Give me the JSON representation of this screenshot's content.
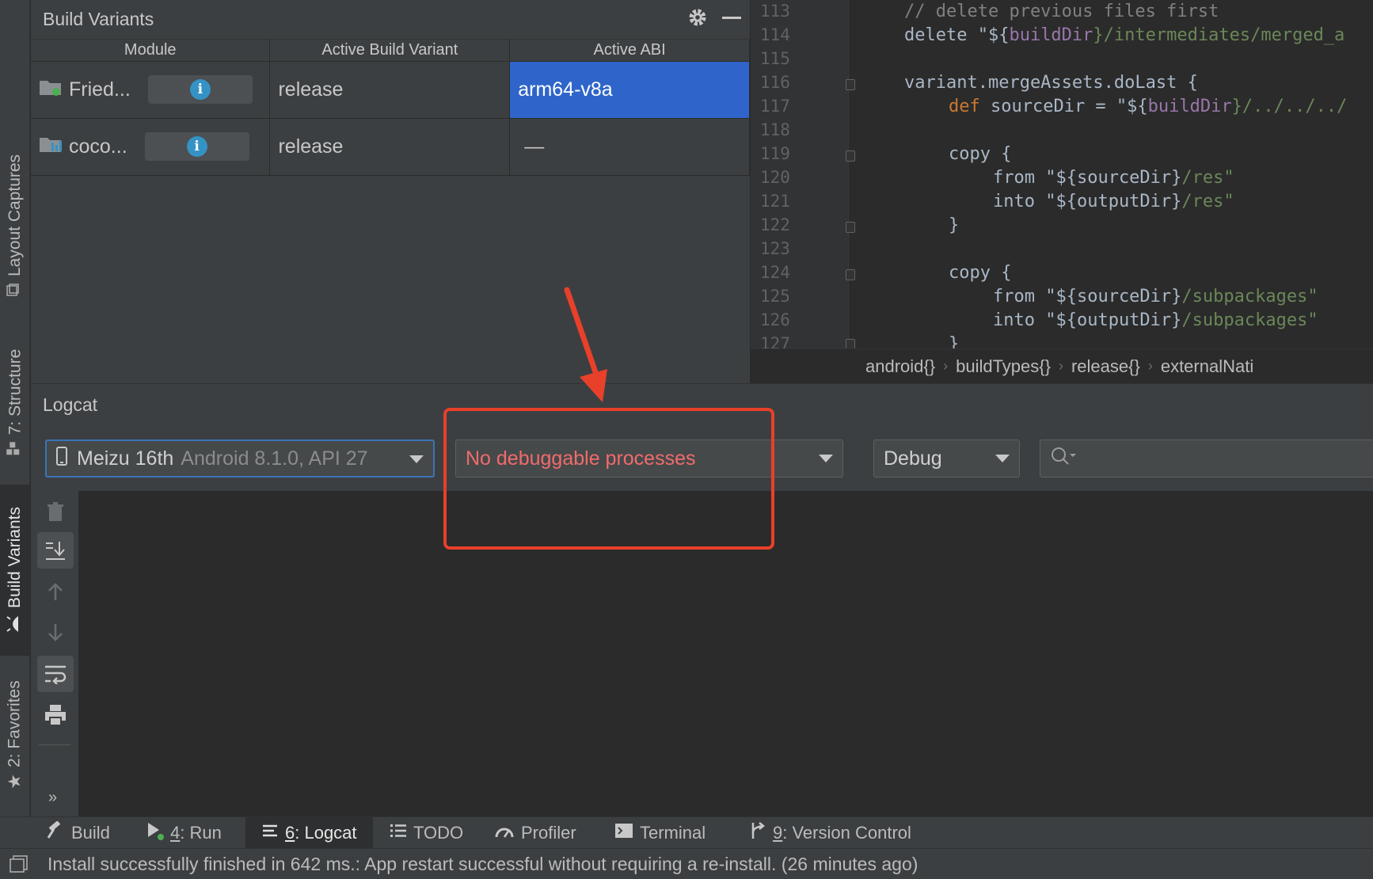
{
  "side_tabs": {
    "layout_captures": "Layout Captures",
    "structure": "7: Structure",
    "build_variants": "Build Variants",
    "favorites": "2: Favorites"
  },
  "build_variants": {
    "title": "Build Variants",
    "columns": [
      "Module",
      "Active Build Variant",
      "Active ABI"
    ],
    "rows": [
      {
        "module": "Fried...",
        "variant": "release",
        "abi": "arm64-v8a"
      },
      {
        "module": "coco...",
        "variant": "release",
        "abi": "—"
      }
    ]
  },
  "editor": {
    "line_numbers": [
      "113",
      "114",
      "115",
      "116",
      "117",
      "118",
      "119",
      "120",
      "121",
      "122",
      "123",
      "124",
      "125",
      "126",
      "127"
    ],
    "lines": {
      "l113": "// delete previous files first",
      "l114a": "delete \"${",
      "l114b": "buildDir",
      "l114c": "}/intermediates/merged_a",
      "l116": "variant.mergeAssets.doLast {",
      "l117a": "def ",
      "l117b": "sourceDir = \"${",
      "l117c": "buildDir",
      "l117d": "}/../../../",
      "l119": "copy {",
      "l120a": "from \"${sourceDir}",
      "l120b": "/res\"",
      "l121a": "into \"${outputDir}",
      "l121b": "/res\"",
      "l122": "}",
      "l124": "copy {",
      "l125a": "from \"${sourceDir}",
      "l125b": "/subpackages\"",
      "l126a": "into \"${outputDir}",
      "l126b": "/subpackages\"",
      "l127": "}"
    },
    "breadcrumb": [
      "android{}",
      "buildTypes{}",
      "release{}",
      "externalNati"
    ]
  },
  "logcat": {
    "title": "Logcat",
    "device_name": "Meizu 16th",
    "device_detail": "Android 8.1.0, API 27",
    "process": "No debuggable processes",
    "level": "Debug",
    "search_value": ""
  },
  "tool_tabs": [
    {
      "num": "",
      "label": "Build"
    },
    {
      "num": "4",
      "label": ": Run"
    },
    {
      "num": "6",
      "label": ": Logcat"
    },
    {
      "num": "",
      "label": "TODO"
    },
    {
      "num": "",
      "label": "Profiler"
    },
    {
      "num": "",
      "label": "Terminal"
    },
    {
      "num": "9",
      "label": ": Version Control"
    }
  ],
  "status": "Install successfully finished in 642 ms.: App restart successful without requiring a re-install. (26 minutes ago)",
  "colors": {
    "accent_selected": "#2f65ca",
    "annotation": "#e8402a",
    "process_text": "#f26b6b"
  }
}
